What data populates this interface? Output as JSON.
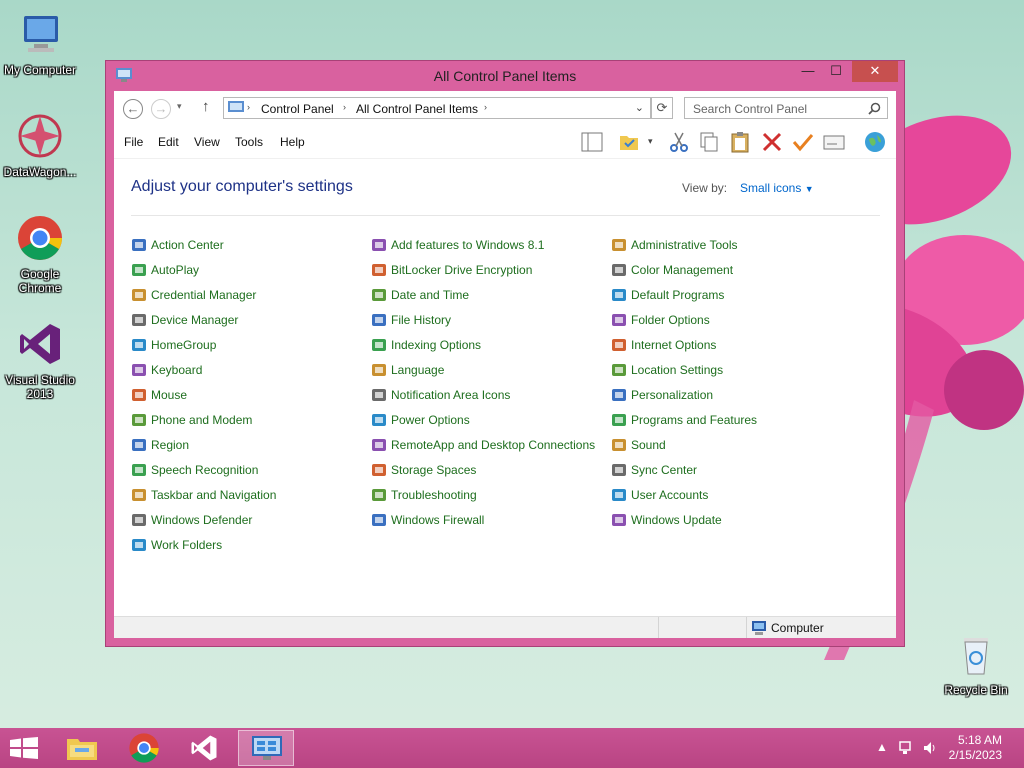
{
  "desktop": {
    "icons": [
      {
        "label": "My Computer",
        "icon": "computer-icon"
      },
      {
        "label": "DataWagon...",
        "icon": "datawagon-icon"
      },
      {
        "label": "Google Chrome",
        "icon": "chrome-icon"
      },
      {
        "label": "Visual Studio 2013",
        "icon": "visual-studio-icon"
      },
      {
        "label": "Recycle Bin",
        "icon": "recycle-bin-icon"
      }
    ]
  },
  "window": {
    "title": "All Control Panel Items",
    "controls": {
      "minimize": "—",
      "maximize": "☐",
      "close": "✕"
    }
  },
  "address": {
    "crumbs": [
      "Control Panel",
      "All Control Panel Items"
    ],
    "search_placeholder": "Search Control Panel"
  },
  "menu": [
    "File",
    "Edit",
    "View",
    "Tools",
    "Help"
  ],
  "content": {
    "heading": "Adjust your computer's settings",
    "view_by_label": "View by:",
    "view_by_value": "Small icons",
    "columns": [
      [
        "Action Center",
        "AutoPlay",
        "Credential Manager",
        "Device Manager",
        "HomeGroup",
        "Keyboard",
        "Mouse",
        "Phone and Modem",
        "Region",
        "Speech Recognition",
        "Taskbar and Navigation",
        "Windows Defender",
        "Work Folders"
      ],
      [
        "Add features to Windows 8.1",
        "BitLocker Drive Encryption",
        "Date and Time",
        "File History",
        "Indexing Options",
        "Language",
        "Notification Area Icons",
        "Power Options",
        "RemoteApp and Desktop Connections",
        "Storage Spaces",
        "Troubleshooting",
        "Windows Firewall"
      ],
      [
        "Administrative Tools",
        "Color Management",
        "Default Programs",
        "Folder Options",
        "Internet Options",
        "Location Settings",
        "Personalization",
        "Programs and Features",
        "Sound",
        "Sync Center",
        "User Accounts",
        "Windows Update"
      ]
    ]
  },
  "status": {
    "location": "Computer"
  },
  "taskbar": {
    "apps": [
      "start-icon",
      "file-explorer-icon",
      "chrome-icon",
      "visual-studio-icon",
      "control-panel-icon"
    ],
    "time": "5:18 AM",
    "date": "2/15/2023"
  },
  "colors": {
    "accent": "#d9619f",
    "link": "#1e6e1e",
    "heading": "#1e3287"
  }
}
